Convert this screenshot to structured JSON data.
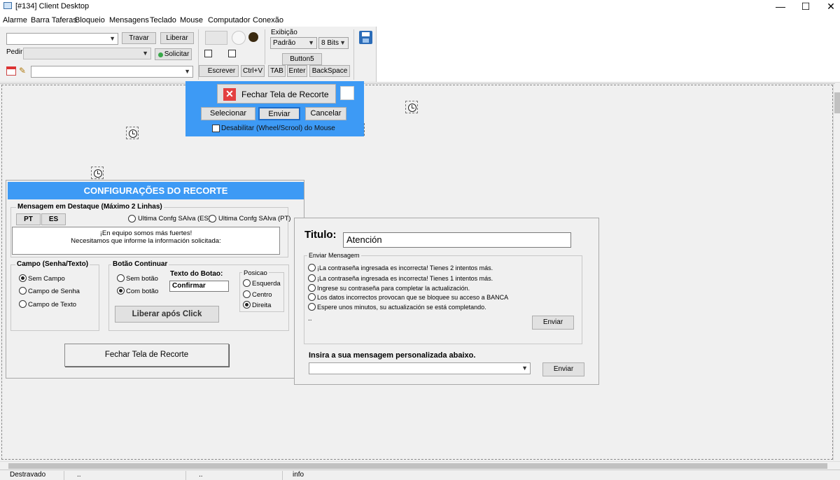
{
  "window": {
    "title": "[#134] Client Desktop",
    "minimize": "—",
    "maximize": "☐",
    "close": "✕"
  },
  "menu": [
    "Alarme",
    "Barra Taferas",
    "Bloqueio",
    "Mensagens",
    "Teclado",
    "Mouse",
    "Computador",
    "Conexão"
  ],
  "toolbar": {
    "combo1_value": "",
    "travar": "Travar",
    "liberar": "Liberar",
    "pedir_label": "Pedir",
    "solicitar": "Solicitar",
    "combo3_value": "",
    "escrever": "Escrever",
    "ctrlv": "Ctrl+V",
    "tab": "TAB",
    "enter": "Enter",
    "backspace": "BackSpace",
    "exibicao_label": "Exibição",
    "exibicao_value": "Padrão",
    "bits_value": "8 Bits",
    "button5": "Button5"
  },
  "overlay": {
    "close_capture": "Fechar Tela de Recorte",
    "selecionar": "Selecionar",
    "enviar": "Enviar",
    "cancelar": "Cancelar",
    "disable_mouse": "Desabilitar (Wheel/Scrool) do Mouse"
  },
  "settings": {
    "header": "CONFIGURAÇÕES DO RECORTE",
    "highlight_group": "Mensagem em Destaque (Máximo 2 Linhas)",
    "pt": "PT",
    "es": "ES",
    "last_es": "Ultima Confg SAlva (ES)",
    "last_pt": "Ultima Confg SAlva (PT)",
    "message_line1": "¡En equipo somos más fuertes!",
    "message_line2": "Necesitamos que informe la información solicitada:",
    "campo_group": "Campo  (Senha/Texto)",
    "sem_campo": "Sem Campo",
    "campo_senha": "Campo de Senha",
    "campo_texto": "Campo de Texto",
    "botao_group": "Botão Continuar",
    "sem_botao": "Sem botão",
    "com_botao": "Com botão",
    "texto_botao_label": "Texto do Botao:",
    "texto_botao_value": "Confirmar",
    "posicao_group": "Posicao",
    "esquerda": "Esquerda",
    "centro": "Centro",
    "direita": "Direita",
    "liberar_click": "Liberar após Click",
    "close_capture": "Fechar Tela de Recorte"
  },
  "message_panel": {
    "titulo_label": "Titulo:",
    "titulo_value": "Atención",
    "send_group": "Enviar Mensagem",
    "options": [
      "¡La contraseña ingresada es incorrecta! Tienes 2 intentos más.",
      "¡La contraseña ingresada es incorrecta! Tienes 1 intentos más.",
      "Ingrese su contraseña para completar la actualización.",
      "Los datos incorrectos provocan que se bloquee su acceso a BANCA",
      "Espere unos minutos, su actualización se está completando."
    ],
    "dots": "..",
    "enviar": "Enviar",
    "custom_label": "Insira a sua mensagem personalizada abaixo.",
    "custom_value": "",
    "enviar2": "Enviar"
  },
  "status": {
    "cell1": "Destravado",
    "cell2": "..",
    "cell3": "..",
    "cell4": "info"
  }
}
